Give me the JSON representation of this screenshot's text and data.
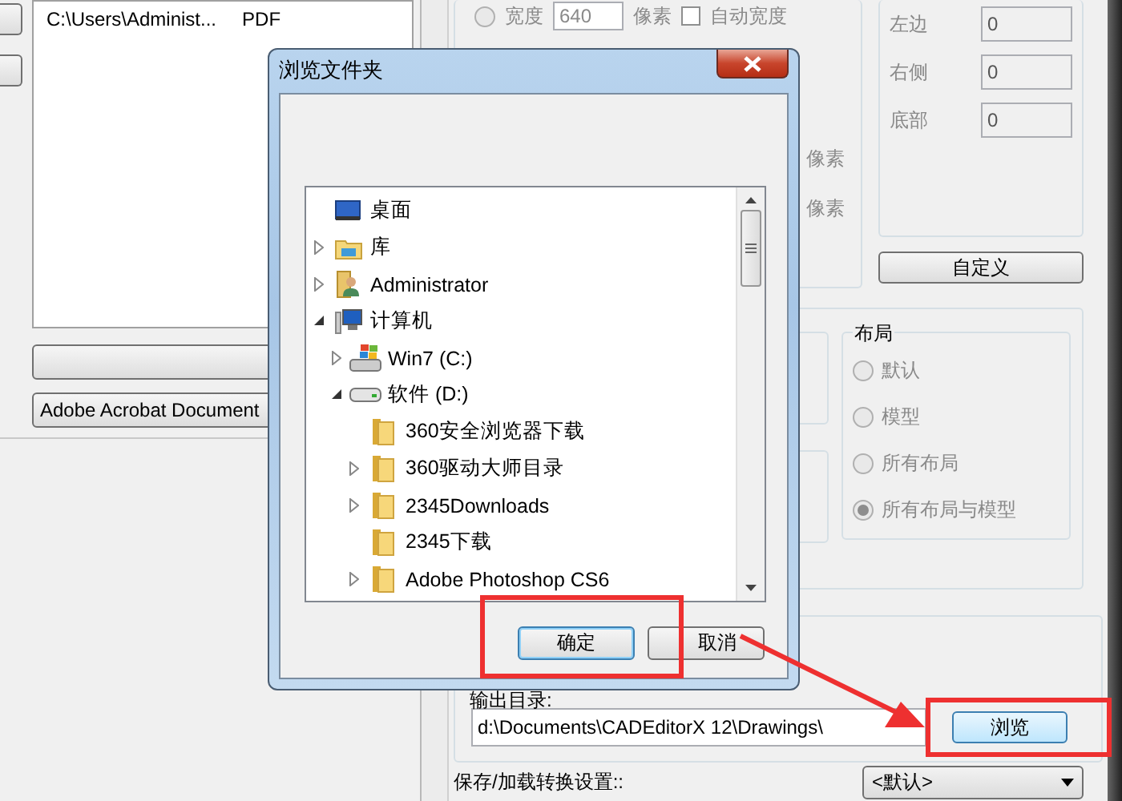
{
  "background_window": {
    "file_list": {
      "rows": [
        {
          "path": "C:\\Users\\Administ...",
          "type": "PDF"
        }
      ]
    },
    "format_button": "Adobe Acrobat Document",
    "size": {
      "radio_selected": false,
      "width_label": "宽度",
      "width_value": "640",
      "width_unit": "像素",
      "auto_width": {
        "label": "自动宽度",
        "checked": false
      },
      "units": [
        "像素",
        "像素"
      ]
    },
    "margins": [
      {
        "label": "左边",
        "value": "0",
        "disabled": true
      },
      {
        "label": "右侧",
        "value": "0",
        "disabled": true
      },
      {
        "label": "底部",
        "value": "0",
        "disabled": true
      }
    ],
    "custom_button": "自定义",
    "layout": {
      "title": "布局",
      "options": [
        {
          "label": "默认",
          "selected": false,
          "disabled": true
        },
        {
          "label": "模型",
          "selected": false,
          "disabled": true
        },
        {
          "label": "所有布局",
          "selected": false,
          "disabled": true
        },
        {
          "label": "所有布局与模型",
          "selected": true,
          "disabled": true
        }
      ]
    },
    "output_dir": {
      "label": "输出目录:",
      "value": "d:\\Documents\\CADEditorX 12\\Drawings\\"
    },
    "browse_button": "浏览",
    "preset": {
      "label": "保存/加载转换设置::",
      "value": "<默认>"
    }
  },
  "dialog": {
    "title": "浏览文件夹",
    "tree": [
      {
        "label": "桌面",
        "kind": "desktop"
      },
      {
        "label": "库",
        "kind": "library",
        "expanded": false
      },
      {
        "label": "Administrator",
        "kind": "user",
        "expanded": false
      },
      {
        "label": "计算机",
        "kind": "computer",
        "expanded": true,
        "children": [
          {
            "label": "Win7 (C:)",
            "kind": "system-drive",
            "expanded": false
          },
          {
            "label": "软件 (D:)",
            "kind": "drive",
            "expanded": true,
            "children": [
              {
                "label": "360安全浏览器下载",
                "kind": "folder"
              },
              {
                "label": "360驱动大师目录",
                "kind": "folder",
                "expanded": false
              },
              {
                "label": "2345Downloads",
                "kind": "folder",
                "expanded": false
              },
              {
                "label": "2345下载",
                "kind": "folder"
              },
              {
                "label": "Adobe Photoshop CS6",
                "kind": "folder",
                "expanded": false
              }
            ]
          }
        ]
      }
    ],
    "ok_button": "确定",
    "cancel_button": "取消"
  },
  "annotations": [
    {
      "kind": "box"
    },
    {
      "kind": "box"
    },
    {
      "kind": "arrow"
    }
  ]
}
